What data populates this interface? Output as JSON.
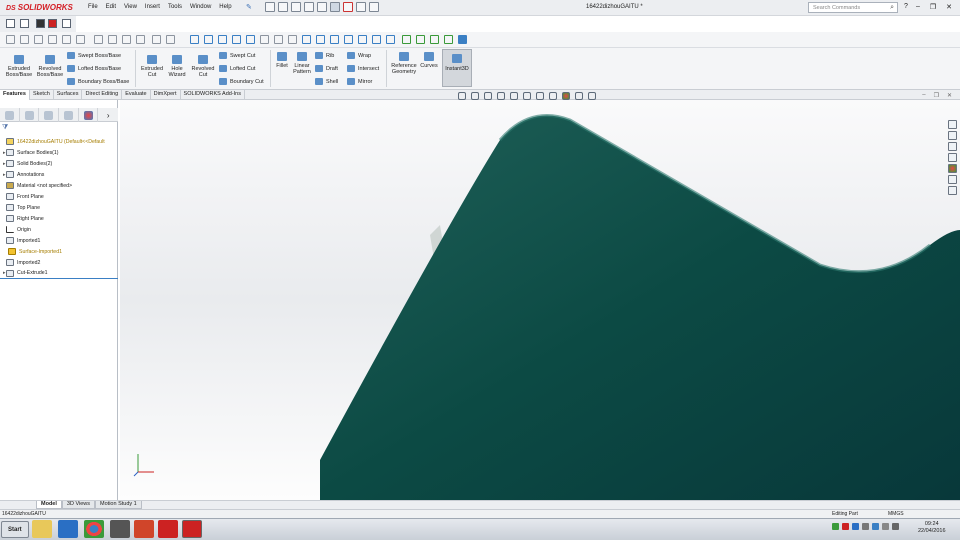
{
  "app": {
    "brand": "SOLIDWORKS",
    "brand_prefix": "DS"
  },
  "menu": [
    "File",
    "Edit",
    "View",
    "Insert",
    "Tools",
    "Window",
    "Help"
  ],
  "document_title": "16422dizhouGAITU *",
  "search_placeholder": "Search Commands",
  "ribbon": {
    "extruded_boss": "Extruded Boss/Base",
    "revolved_boss": "Revolved Boss/Base",
    "swept_boss": "Swept Boss/Base",
    "lofted_boss": "Lofted Boss/Base",
    "boundary_boss": "Boundary Boss/Base",
    "extruded_cut": "Extruded Cut",
    "hole_wizard": "Hole Wizard",
    "revolved_cut": "Revolved Cut",
    "swept_cut": "Swept Cut",
    "lofted_cut": "Lofted Cut",
    "boundary_cut": "Boundary Cut",
    "fillet": "Fillet",
    "linear_pattern": "Linear Pattern",
    "rib": "Rib",
    "draft": "Draft",
    "shell": "Shell",
    "wrap": "Wrap",
    "intersect": "Intersect",
    "mirror": "Mirror",
    "reference_geometry": "Reference Geometry",
    "curves": "Curves",
    "instant3d": "Instant3D"
  },
  "command_tabs": [
    "Features",
    "Sketch",
    "Surfaces",
    "Direct Editing",
    "Evaluate",
    "DimXpert",
    "SOLIDWORKS Add-Ins"
  ],
  "feature_tree": {
    "root": "16422dizhouGAITU  (Default<<Default",
    "items": [
      {
        "label": "Surface Bodies(1)",
        "expand": true
      },
      {
        "label": "Solid Bodies(2)",
        "expand": true
      },
      {
        "label": "Annotations",
        "expand": true
      },
      {
        "label": "Material <not specified>",
        "expand": false
      },
      {
        "label": "Front Plane",
        "expand": false
      },
      {
        "label": "Top Plane",
        "expand": false
      },
      {
        "label": "Right Plane",
        "expand": false
      },
      {
        "label": "Origin",
        "expand": false
      },
      {
        "label": "Imported1",
        "expand": false
      },
      {
        "label": "Surface-Imported1",
        "expand": false
      },
      {
        "label": "Imported2",
        "expand": false
      },
      {
        "label": "Cut-Extrude1",
        "expand": true
      }
    ]
  },
  "bottom_tabs": [
    "Model",
    "3D Views",
    "Motion Study 1"
  ],
  "status": {
    "file": "16422dizhouGAITU",
    "editing": "Editing Part",
    "units": "MMGS"
  },
  "taskbar": {
    "start": "Start",
    "time": "09:24",
    "date": "22/04/2016"
  },
  "colors": {
    "model": "#0c4a44",
    "accent": "#d42027"
  }
}
